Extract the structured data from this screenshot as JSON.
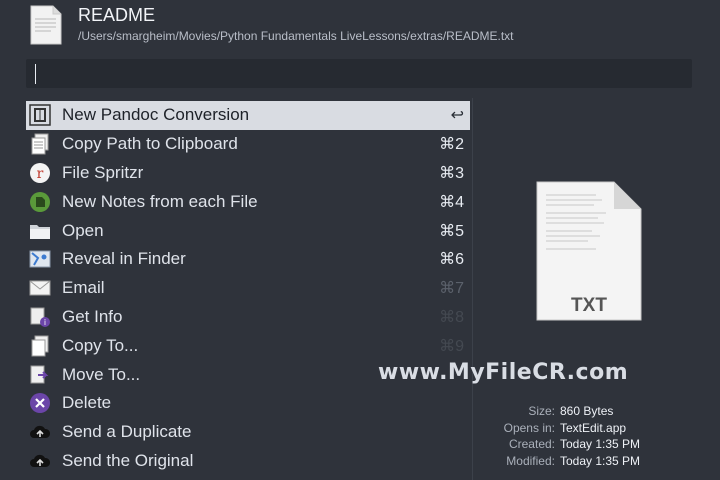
{
  "header": {
    "title": "README",
    "path": "/Users/smargheim/Movies/Python Fundamentals LiveLessons/extras/README.txt"
  },
  "search": {
    "value": ""
  },
  "actions": [
    {
      "label": "New Pandoc Conversion",
      "shortcut": "↩",
      "icon": "pandoc-icon"
    },
    {
      "label": "Copy Path to Clipboard",
      "shortcut": "⌘2",
      "icon": "clipboard-icon"
    },
    {
      "label": "File Spritzr",
      "shortcut": "⌘3",
      "icon": "spritzr-icon"
    },
    {
      "label": "New Notes from each File",
      "shortcut": "⌘4",
      "icon": "evernote-icon"
    },
    {
      "label": "Open",
      "shortcut": "⌘5",
      "icon": "folder-icon"
    },
    {
      "label": "Reveal in Finder",
      "shortcut": "⌘6",
      "icon": "finder-icon"
    },
    {
      "label": "Email",
      "shortcut": "⌘7",
      "icon": "envelope-icon"
    },
    {
      "label": "Get Info",
      "shortcut": "⌘8",
      "icon": "info-icon"
    },
    {
      "label": "Copy To...",
      "shortcut": "⌘9",
      "icon": "copy-icon"
    },
    {
      "label": "Move To...",
      "shortcut": "",
      "icon": "move-icon"
    },
    {
      "label": "Delete",
      "shortcut": "",
      "icon": "delete-icon"
    },
    {
      "label": "Send a Duplicate",
      "shortcut": "",
      "icon": "cloud-upload-icon"
    },
    {
      "label": "Send the Original",
      "shortcut": "",
      "icon": "cloud-upload-icon"
    }
  ],
  "preview": {
    "type_label": "TXT"
  },
  "watermark": "www.MyFileCR.com",
  "meta": {
    "size_label": "Size:",
    "size": "860 Bytes",
    "opens_label": "Opens in:",
    "opens": "TextEdit.app",
    "created_label": "Created:",
    "created": "Today 1:35 PM",
    "modified_label": "Modified:",
    "modified": "Today 1:35 PM"
  },
  "colors": {
    "background": "#2f333b",
    "selected": "#d9dce2",
    "search": "#262a31"
  }
}
